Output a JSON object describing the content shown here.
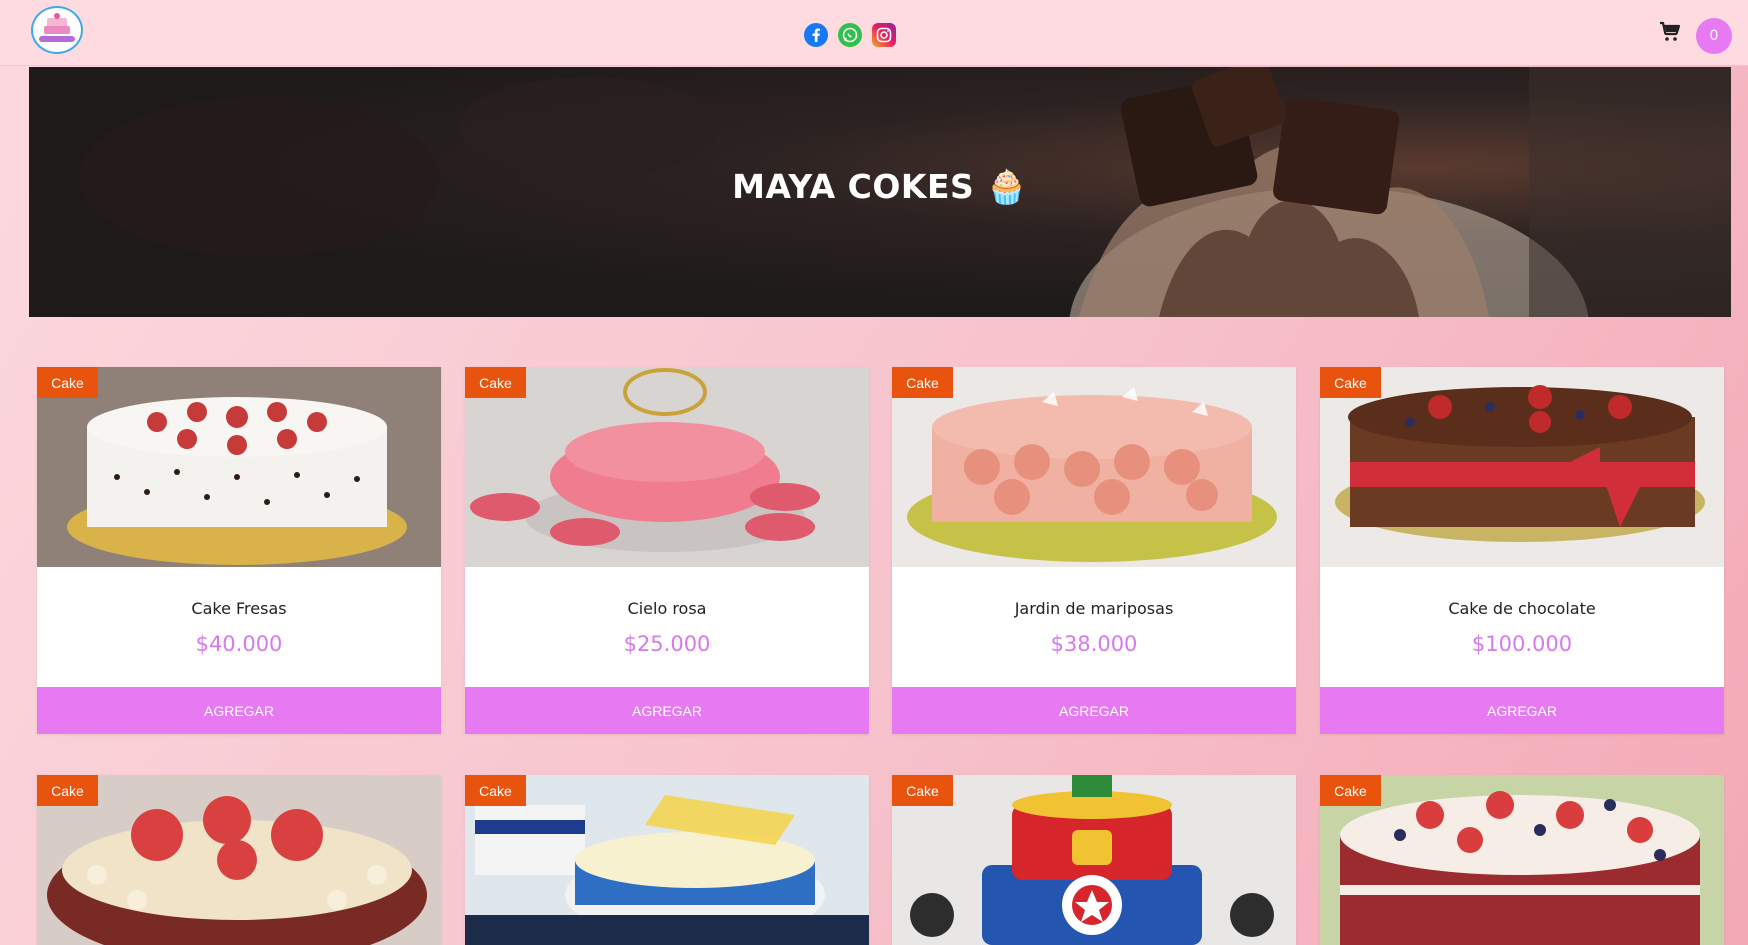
{
  "header": {
    "logo_alt": "Maya Cokes logo",
    "social": [
      "facebook-icon",
      "whatsapp-icon",
      "instagram-icon"
    ],
    "cart_count": "0"
  },
  "hero": {
    "title": "MAYA COKES 🧁"
  },
  "colors": {
    "accent": "#e77af3",
    "tag": "#e8530e",
    "price": "#d679ea",
    "header_bg": "#fddbe0"
  },
  "products": [
    {
      "tag": "Cake",
      "name": "Cake Fresas",
      "price": "$40.000",
      "button": "AGREGAR"
    },
    {
      "tag": "Cake",
      "name": "Cielo rosa",
      "price": "$25.000",
      "button": "AGREGAR"
    },
    {
      "tag": "Cake",
      "name": "Jardin de mariposas",
      "price": "$38.000",
      "button": "AGREGAR"
    },
    {
      "tag": "Cake",
      "name": "Cake de chocolate",
      "price": "$100.000",
      "button": "AGREGAR"
    },
    {
      "tag": "Cake"
    },
    {
      "tag": "Cake"
    },
    {
      "tag": "Cake"
    },
    {
      "tag": "Cake"
    }
  ]
}
